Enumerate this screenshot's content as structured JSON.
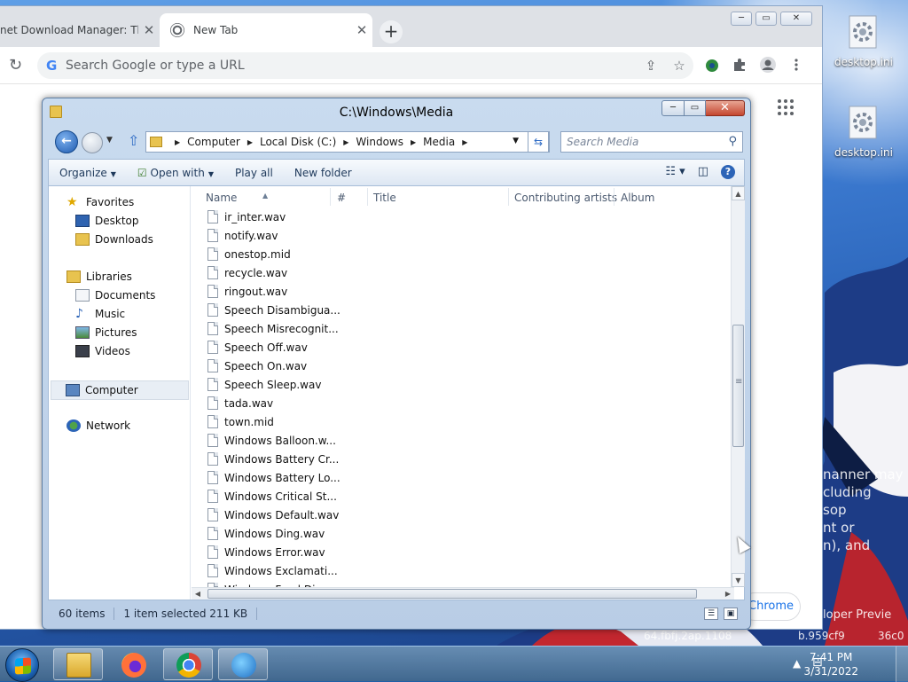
{
  "desktop": {
    "icons": [
      {
        "label": "desktop.ini"
      },
      {
        "label": "desktop.ini"
      }
    ],
    "background_text": [
      "nanner may",
      "cluding",
      "sop",
      "nt or",
      "n), and",
      "loper Previe",
      "64.fbfj.2ap.1108",
      "b.959cf9",
      "36c0"
    ]
  },
  "chrome": {
    "tabs": [
      {
        "title": "net Download Manager: The",
        "close": "✕"
      },
      {
        "title": "New Tab",
        "close": "✕"
      }
    ],
    "new_tab_label": "+",
    "window_controls": [
      "─",
      "▭",
      "✕"
    ],
    "reload_icon": "↻",
    "google_g": "G",
    "omnibox_placeholder": "Search Google or type a URL",
    "share_icon": "⇪",
    "star_icon": "☆",
    "apps_icon": "⋮⋮",
    "chrome_pill": "Chrome"
  },
  "explorer": {
    "title": "C:\\Windows\\Media",
    "window_controls": {
      "minimize": "─",
      "maximize": "▭",
      "close": "✕"
    },
    "address_crumbs": [
      "Computer",
      "Local Disk (C:)",
      "Windows",
      "Media"
    ],
    "search_placeholder": "Search Media",
    "commands": {
      "organize": "Organize",
      "open_with": "Open with",
      "play_all": "Play all",
      "new_folder": "New folder"
    },
    "nav": {
      "favorites": "Favorites",
      "desktop": "Desktop",
      "downloads": "Downloads",
      "libraries": "Libraries",
      "documents": "Documents",
      "music": "Music",
      "pictures": "Pictures",
      "videos": "Videos",
      "computer": "Computer",
      "network": "Network"
    },
    "columns": [
      "Name",
      "#",
      "Title",
      "Contributing artists",
      "Album"
    ],
    "files": [
      "ir_inter.wav",
      "notify.wav",
      "onestop.mid",
      "recycle.wav",
      "ringout.wav",
      "Speech Disambigua...",
      "Speech Misrecognit...",
      "Speech Off.wav",
      "Speech On.wav",
      "Speech Sleep.wav",
      "tada.wav",
      "town.mid",
      "Windows Balloon.w...",
      "Windows Battery Cr...",
      "Windows Battery Lo...",
      "Windows Critical St...",
      "Windows Default.wav",
      "Windows Ding.wav",
      "Windows Error.wav",
      "Windows Exclamati...",
      "Windows Feed Dis..."
    ],
    "status": {
      "count": "60 items",
      "selection": "1 item selected  211 KB"
    }
  },
  "taskbar": {
    "clock_time": "7:41 PM",
    "clock_date": "3/31/2022"
  },
  "colors": {
    "explorer_frame": "#c9dbef",
    "close_button": "#c4462f",
    "taskbar": "#2e5678",
    "desktop_sky": "#3f7ed4"
  }
}
